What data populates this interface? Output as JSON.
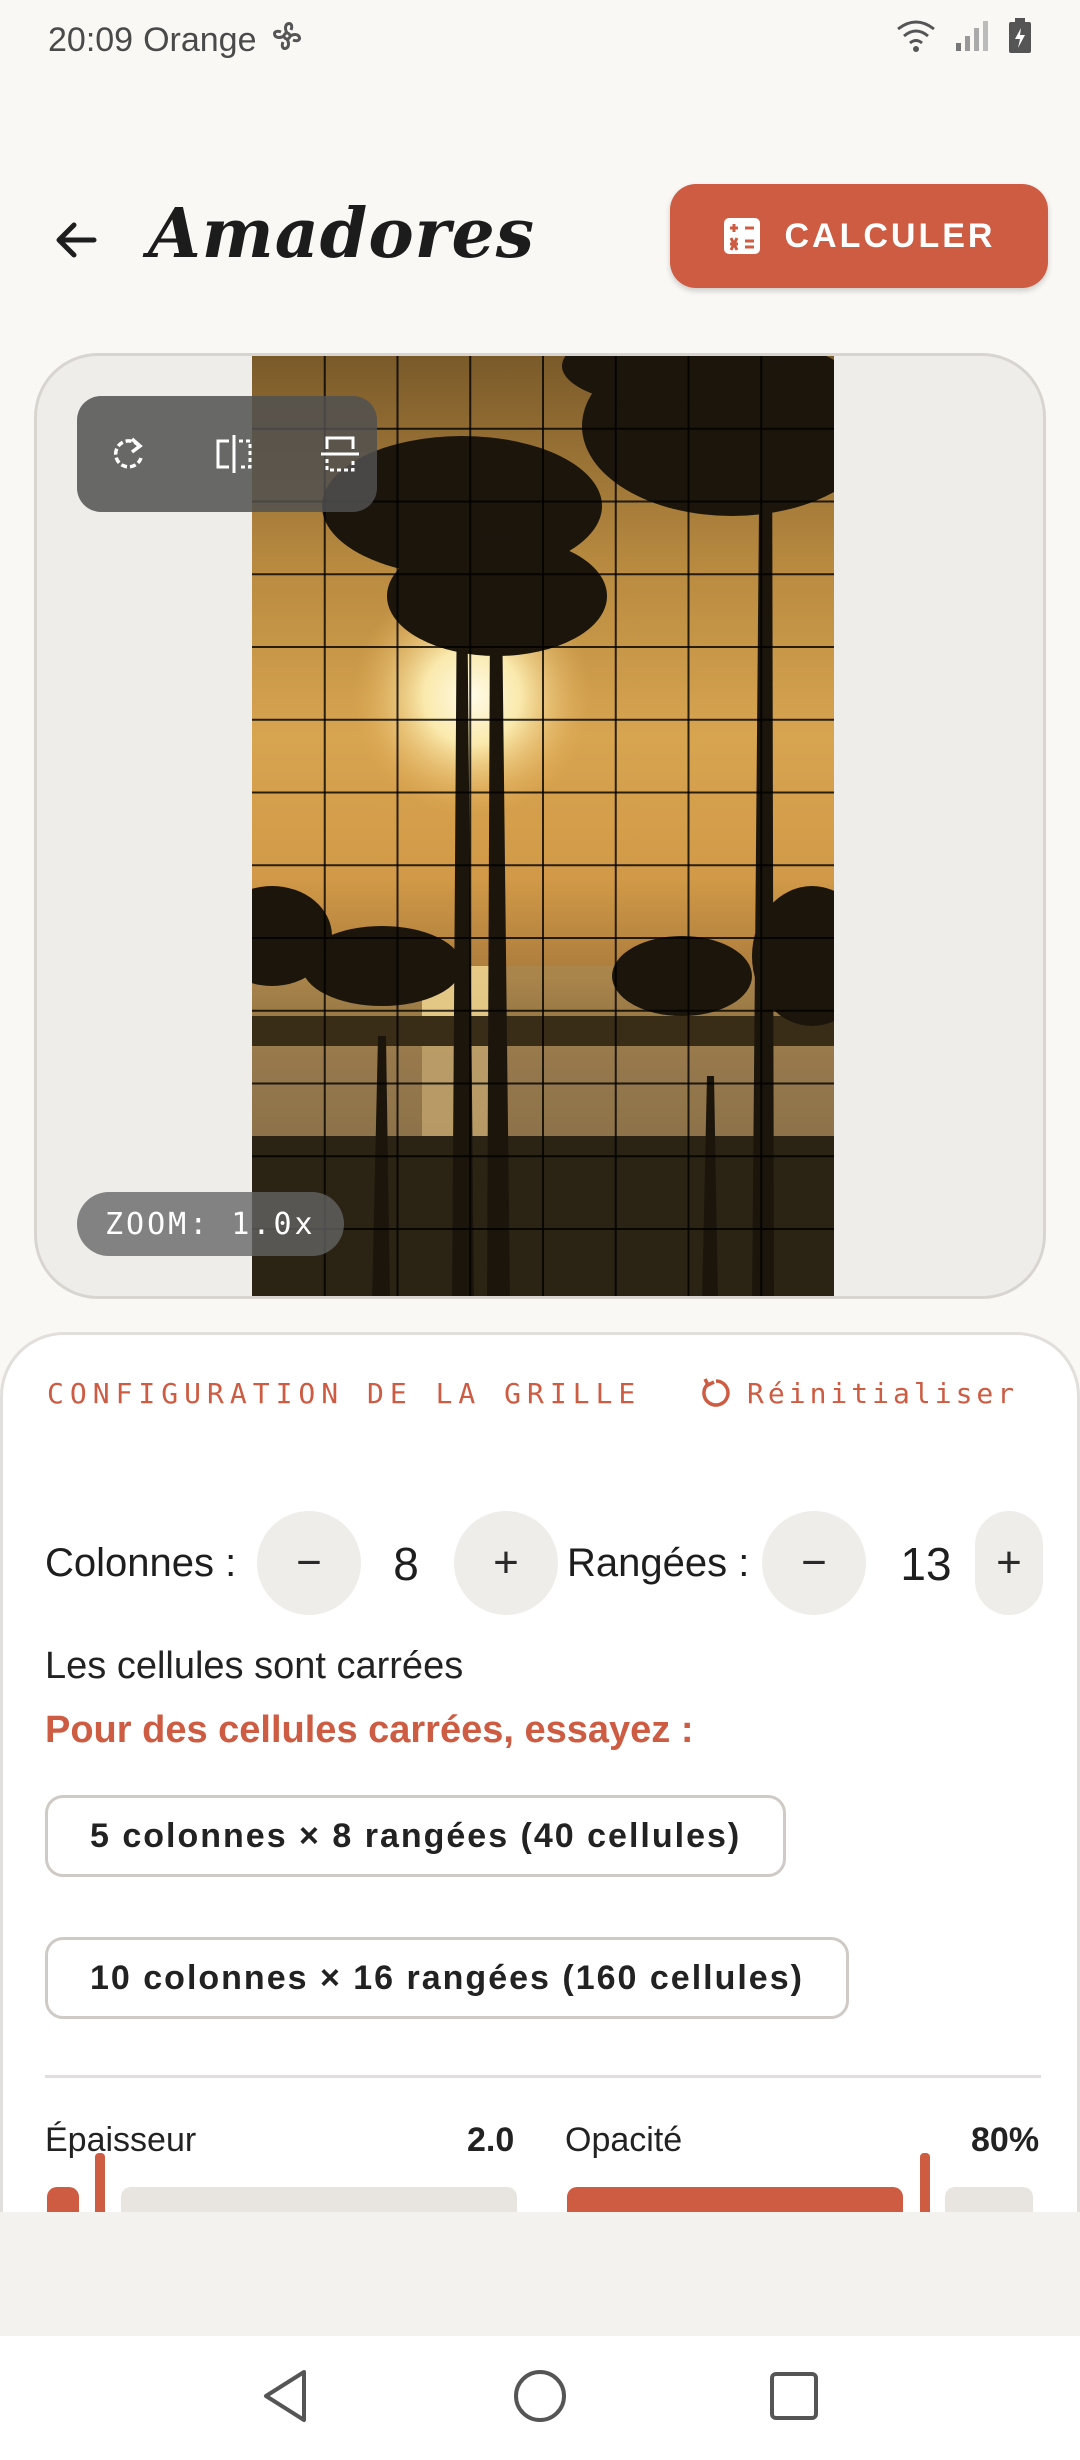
{
  "status": {
    "time": "20:09",
    "carrier": "Orange"
  },
  "header": {
    "title": "Amadores",
    "calc_label": "CALCULER"
  },
  "preview": {
    "zoom_label": "ZOOM: 1.0x",
    "columns": 8,
    "rows": 13
  },
  "config": {
    "section_title": "CONFIGURATION DE LA GRILLE",
    "reset_label": "Réinitialiser",
    "columns_label": "Colonnes :",
    "columns_value": "8",
    "rows_label": "Rangées :",
    "rows_value": "13",
    "minus_symbol": "−",
    "plus_symbol": "+",
    "square_note": "Les cellules sont carrées",
    "suggest_title": "Pour des cellules carrées, essayez :",
    "suggestions": [
      "5 colonnes × 8 rangées (40 cellules)",
      "10 colonnes × 16 rangées (160 cellules)"
    ],
    "thickness_label": "Épaisseur",
    "thickness_value": "2.0",
    "thickness_fraction": 0.08,
    "opacity_label": "Opacité",
    "opacity_value": "80%",
    "opacity_fraction": 0.8
  },
  "colors": {
    "accent": "#cd5c43",
    "surface": "#efedea",
    "background": "#faf8f5"
  }
}
